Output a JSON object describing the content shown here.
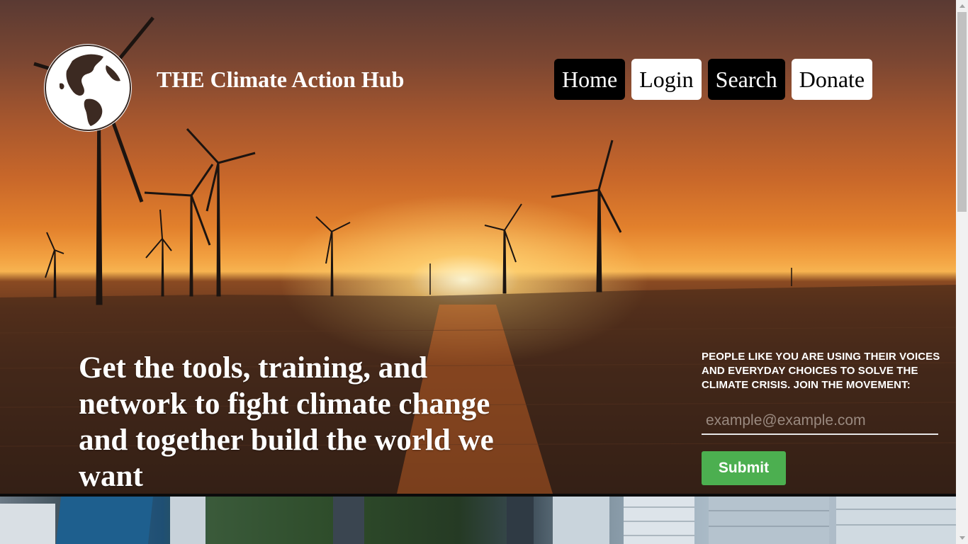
{
  "header": {
    "site_title": "THE Climate Action Hub",
    "logo_icon": "globe-icon"
  },
  "nav": {
    "items": [
      {
        "label": "Home",
        "style": "dark"
      },
      {
        "label": "Login",
        "style": "light"
      },
      {
        "label": "Search",
        "style": "dark"
      },
      {
        "label": "Donate",
        "style": "light"
      }
    ]
  },
  "hero": {
    "headline": "Get the tools, training, and network to fight climate change and together build the world we want"
  },
  "signup": {
    "text": "People like you are using their voices and everyday choices to solve the climate crisis. Join the movement:",
    "email_placeholder": "example@example.com",
    "email_value": "",
    "submit_label": "Submit"
  },
  "colors": {
    "submit": "#4caf50",
    "nav_dark": "#000000",
    "nav_light": "#ffffff",
    "text": "#ffffff"
  }
}
